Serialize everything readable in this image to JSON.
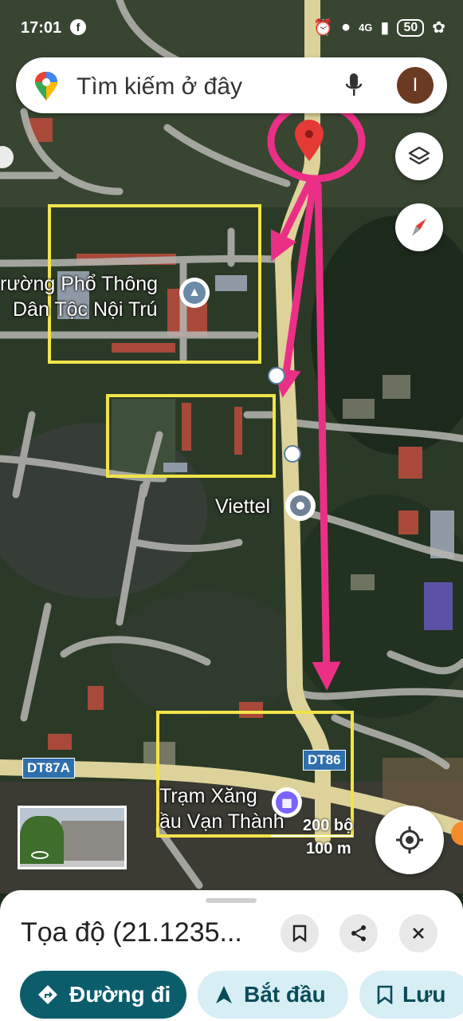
{
  "status_bar": {
    "time": "17:01",
    "facebook_glyph": "f",
    "network": "4G",
    "battery": "50"
  },
  "search": {
    "placeholder": "Tìm kiếm ở đây",
    "avatar_letter": "I"
  },
  "map": {
    "places": [
      {
        "label_line1": "rường Phổ Thông",
        "label_line2": "Dân Tộc Nội Trú",
        "icon": "school-icon"
      },
      {
        "label": "Viettel",
        "icon": "place-pin-icon"
      },
      {
        "label_line1": "Trạm Xăng",
        "label_line2": "ầu Vạn Thành",
        "icon": "gas-station-icon"
      }
    ],
    "road_labels": [
      "DT87A",
      "DT86"
    ],
    "scale": {
      "imperial": "200 bộ",
      "metric": "100 m"
    },
    "annotation_colors": {
      "highlight_box": "#f2e34a",
      "arrow": "#ec2f86"
    }
  },
  "bottom_sheet": {
    "title": "Tọa độ (21.1235...",
    "actions": [
      {
        "label": "Đường đi",
        "icon": "directions-icon"
      },
      {
        "label": "Bắt đầu",
        "icon": "navigation-icon"
      },
      {
        "label": "Lưu",
        "icon": "bookmark-icon"
      }
    ]
  }
}
